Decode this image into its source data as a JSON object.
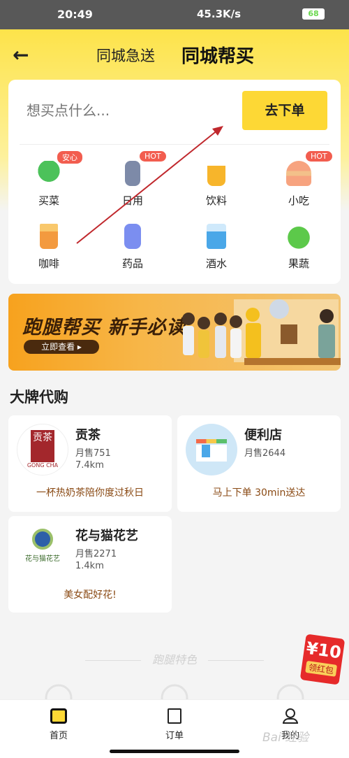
{
  "status": {
    "time": "20:49",
    "speed": "45.3K/s",
    "battery": "68"
  },
  "header": {
    "tab_express": "同城急送",
    "tab_buy": "同城帮买"
  },
  "search": {
    "placeholder": "想买点什么...",
    "order_label": "去下单"
  },
  "categories": [
    {
      "label": "买菜",
      "badge": "安心"
    },
    {
      "label": "日用",
      "badge": "HOT"
    },
    {
      "label": "饮料",
      "badge": ""
    },
    {
      "label": "小吃",
      "badge": "HOT"
    },
    {
      "label": "咖啡",
      "badge": ""
    },
    {
      "label": "药品",
      "badge": ""
    },
    {
      "label": "酒水",
      "badge": ""
    },
    {
      "label": "果蔬",
      "badge": ""
    }
  ],
  "banner": {
    "title": "跑腿帮买 新手必读",
    "button": "立即查看 ▸"
  },
  "brands": {
    "title": "大牌代购",
    "shops": [
      {
        "name": "贡茶",
        "sales": "月售751",
        "distance": "7.4km",
        "slogan": "一杯热奶茶陪你度过秋日",
        "logo_text": "贡茶",
        "logo_sub": "GONG CHA"
      },
      {
        "name": "便利店",
        "sales": "月售2644",
        "distance": "",
        "slogan": "马上下单 30min送达"
      },
      {
        "name": "花与猫花艺",
        "sales": "月售2271",
        "distance": "1.4km",
        "slogan": "美女配好花!",
        "logo_text": "花与猫花艺"
      }
    ]
  },
  "feature_title": "跑腿特色",
  "red_packet": {
    "amount": "¥10",
    "label": "领红包"
  },
  "nav": {
    "home": "首页",
    "orders": "订单",
    "me": "我的"
  },
  "watermark": "Bai 经验",
  "colors": {
    "accent": "#fdd835",
    "badge": "#f25d4f",
    "annotation_arrow": "#c0282d"
  }
}
